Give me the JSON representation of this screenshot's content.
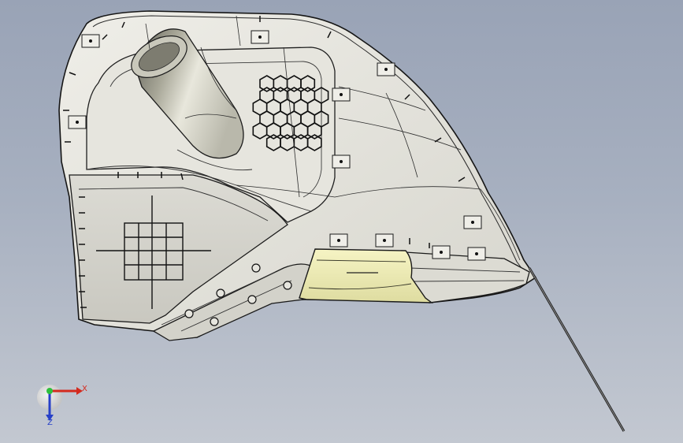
{
  "viewport": {
    "background_top": "#99a3b6",
    "background_bottom": "#c3c8d1",
    "part_color": "#e4e3dc",
    "highlight_color": "#f3f1b8",
    "edge_color": "#1b1b1b"
  },
  "triad": {
    "x_label": "X",
    "z_label": "Z",
    "x_color": "#d42a1e",
    "y_color": "#2fbf3c",
    "z_color": "#2740c8"
  }
}
